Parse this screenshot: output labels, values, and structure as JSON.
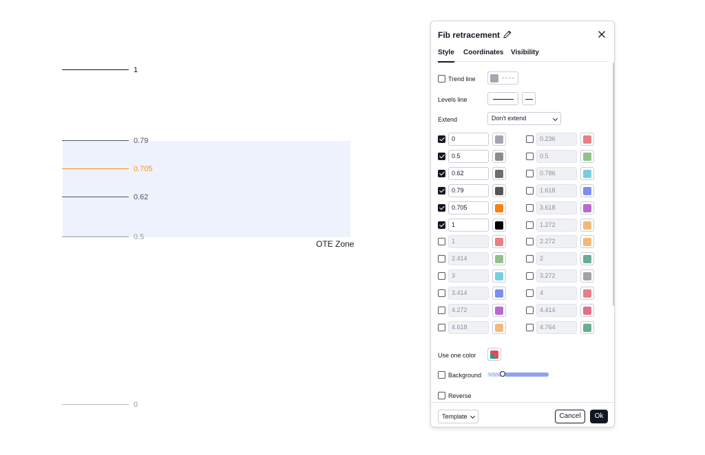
{
  "chart": {
    "zone_label": "OTE Zone",
    "levels": [
      {
        "label": "1",
        "color": "#131722"
      },
      {
        "label": "0.79",
        "color": "#50535e"
      },
      {
        "label": "0.705",
        "color": "#f7931a"
      },
      {
        "label": "0.62",
        "color": "#50535e"
      },
      {
        "label": "0.5",
        "color": "#9598a1"
      },
      {
        "label": "0",
        "color": "#9598a1"
      }
    ],
    "zone_color": "#eef2fc"
  },
  "dialog": {
    "title": "Fib retracement",
    "tabs": [
      "Style",
      "Coordinates",
      "Visibility"
    ],
    "active_tab": "Style",
    "trend_line": {
      "label": "Trend line",
      "checked": false,
      "color": "#a3a6af"
    },
    "levels_line": {
      "label": "Levels line"
    },
    "extend": {
      "label": "Extend",
      "value": "Don't extend"
    },
    "levels_left": [
      {
        "value": "0",
        "checked": true,
        "color": "#a3a6af"
      },
      {
        "value": "0.5",
        "checked": true,
        "color": "#8c8c8c"
      },
      {
        "value": "0.62",
        "checked": true,
        "color": "#6e6e6e"
      },
      {
        "value": "0.79",
        "checked": true,
        "color": "#555555"
      },
      {
        "value": "0.705",
        "checked": true,
        "color": "#f7830f"
      },
      {
        "value": "1",
        "checked": true,
        "color": "#000000"
      },
      {
        "value": "1",
        "checked": false,
        "color": "#e87e86"
      },
      {
        "value": "2.414",
        "checked": false,
        "color": "#90c28a"
      },
      {
        "value": "3",
        "checked": false,
        "color": "#79cde0"
      },
      {
        "value": "3.414",
        "checked": false,
        "color": "#7b8ef2"
      },
      {
        "value": "4.272",
        "checked": false,
        "color": "#b66bcc"
      },
      {
        "value": "4.618",
        "checked": false,
        "color": "#f4b97a"
      }
    ],
    "levels_right": [
      {
        "value": "0.236",
        "checked": false,
        "color": "#e87e86"
      },
      {
        "value": "0.5",
        "checked": false,
        "color": "#90c28a"
      },
      {
        "value": "0.786",
        "checked": false,
        "color": "#79cde0"
      },
      {
        "value": "1.618",
        "checked": false,
        "color": "#7b8ef2"
      },
      {
        "value": "3.618",
        "checked": false,
        "color": "#b66bcc"
      },
      {
        "value": "1.272",
        "checked": false,
        "color": "#f4b97a"
      },
      {
        "value": "2.272",
        "checked": false,
        "color": "#f4b97a"
      },
      {
        "value": "2",
        "checked": false,
        "color": "#6aab94"
      },
      {
        "value": "3.272",
        "checked": false,
        "color": "#a3a3a3"
      },
      {
        "value": "4",
        "checked": false,
        "color": "#e87e86"
      },
      {
        "value": "4.414",
        "checked": false,
        "color": "#e0718a"
      },
      {
        "value": "4.764",
        "checked": false,
        "color": "#6aab94"
      }
    ],
    "use_one_color": {
      "label": "Use one color"
    },
    "background": {
      "label": "Background",
      "checked": false
    },
    "reverse": {
      "label": "Reverse",
      "checked": false
    },
    "template": "Template",
    "cancel": "Cancel",
    "ok": "Ok"
  }
}
